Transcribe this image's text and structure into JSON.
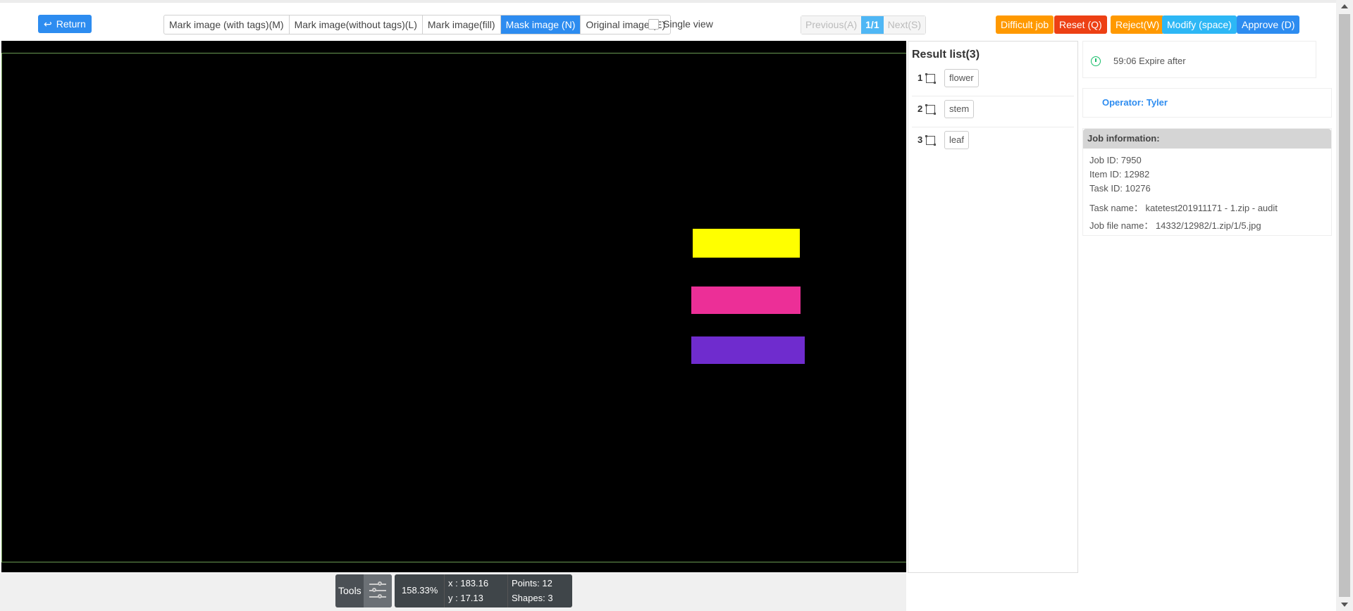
{
  "header": {
    "return_label": "Return",
    "modes": [
      {
        "label": "Mark image (with tags)(M)",
        "active": false
      },
      {
        "label": "Mark image(without tags)(L)",
        "active": false
      },
      {
        "label": "Mark image(fill)",
        "active": false
      },
      {
        "label": "Mask image (N)",
        "active": true
      },
      {
        "label": "Original image (E)",
        "active": false
      }
    ],
    "single_view_label": "Single view",
    "pager": {
      "prev": "Previous(A)",
      "current": "1/1",
      "next": "Next(S)"
    },
    "actions": [
      {
        "label": "Difficult job",
        "color": "#ff9900"
      },
      {
        "label": "Reset (Q)",
        "color": "#ed4014"
      },
      {
        "label": "Reject(W)",
        "color": "#ff9900"
      },
      {
        "label": "Modify (space)",
        "color": "#2db7f5"
      },
      {
        "label": "Approve (D)",
        "color": "#2d8cf0"
      }
    ]
  },
  "canvas": {
    "background": "#000000",
    "masks": [
      {
        "label": "flower",
        "color": "#ffff00"
      },
      {
        "label": "stem",
        "color": "#ec2f97"
      },
      {
        "label": "leaf",
        "color": "#6f2cce"
      }
    ]
  },
  "results": {
    "title": "Result list(3)",
    "items": [
      {
        "index": "1",
        "tag": "flower"
      },
      {
        "index": "2",
        "tag": "stem"
      },
      {
        "index": "3",
        "tag": "leaf"
      }
    ]
  },
  "timer": {
    "text": "59:06 Expire after",
    "icon": "clock-icon"
  },
  "operator": {
    "text": "Operator: Tyler"
  },
  "job_info": {
    "title": "Job information:",
    "job_id": "Job ID: 7950",
    "item_id": "Item ID: 12982",
    "task_id": "Task ID: 10276",
    "task_name": "Task name：  katetest201911171 - 1.zip - audit",
    "job_file": "Job file name：  14332/12982/1.zip/1/5.jpg"
  },
  "footer": {
    "tools_label": "Tools",
    "zoom": "158.33%",
    "x": "x : 183.16",
    "y": "y : 17.13",
    "points": "Points:  12",
    "shapes": "Shapes:  3"
  }
}
